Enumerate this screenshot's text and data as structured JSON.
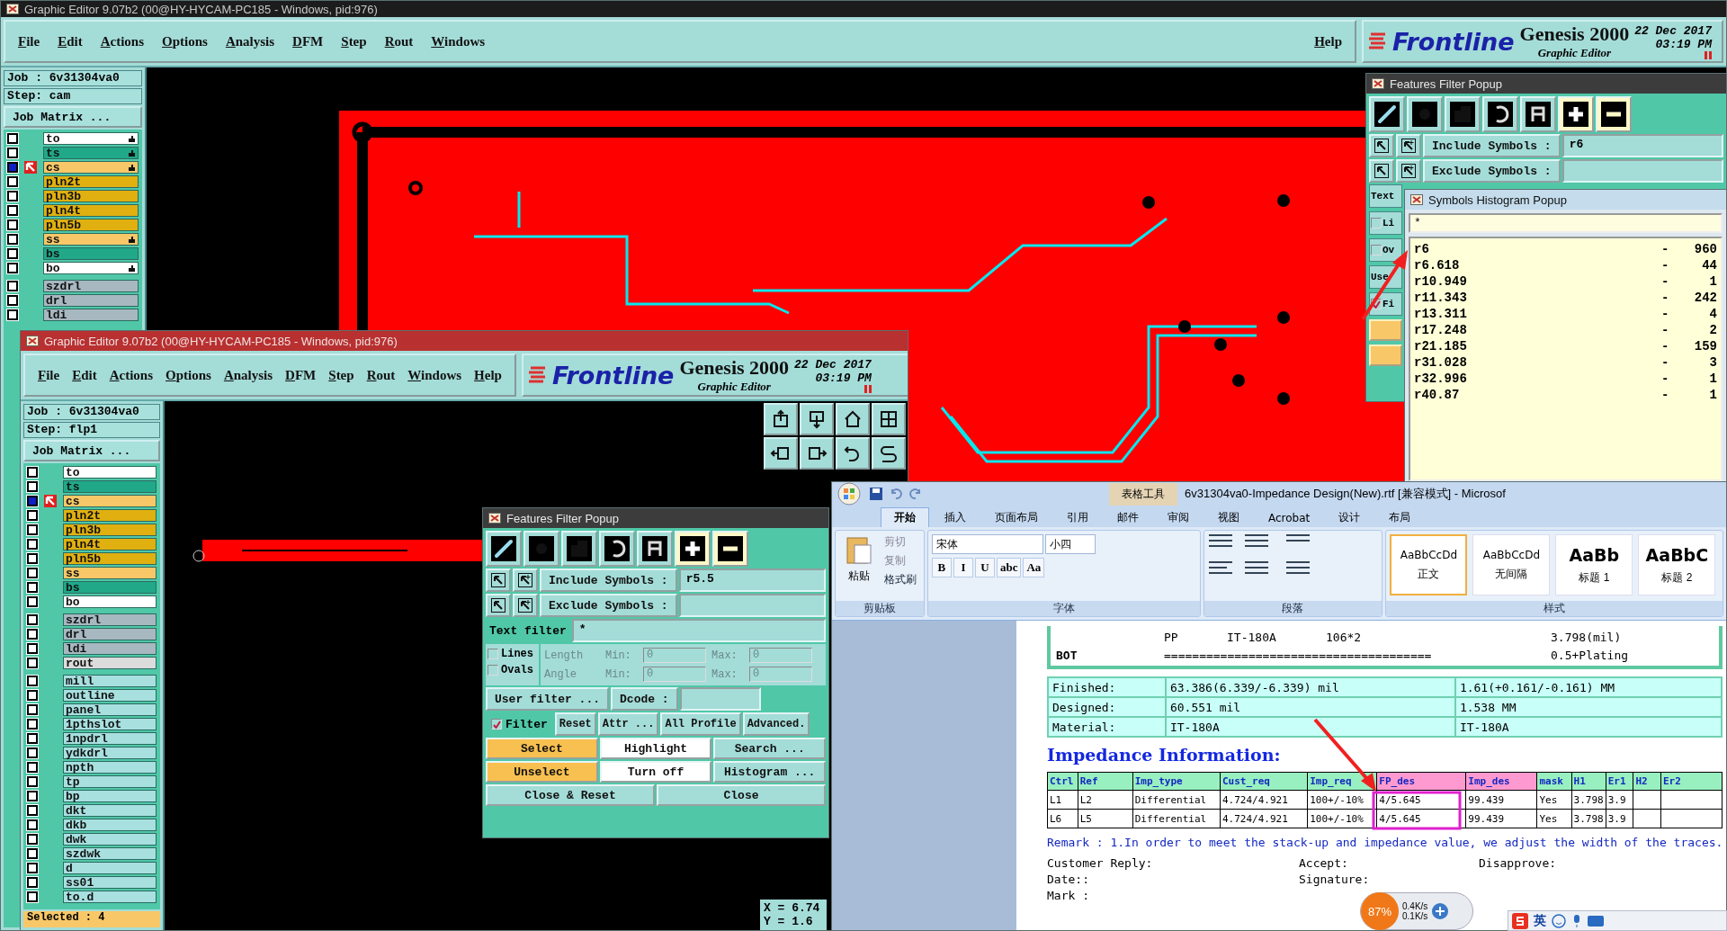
{
  "back_editor": {
    "title": "Graphic Editor 9.07b2 (00@HY-HYCAM-PC185 - Windows, pid:976)",
    "menu": [
      "File",
      "Edit",
      "Actions",
      "Options",
      "Analysis",
      "DFM",
      "Step",
      "Rout",
      "Windows"
    ],
    "help": "Help",
    "job": "Job : 6v31304va0",
    "step": "Step: cam",
    "job_matrix": "Job Matrix ...",
    "layer_groups": [
      {
        "layers": [
          {
            "name": "to",
            "color": "#ffffff",
            "selected": false,
            "affected": true
          },
          {
            "name": "ts",
            "color": "#20a888",
            "selected": false,
            "affected": true
          },
          {
            "name": "cs",
            "color": "#f8c868",
            "selected": true,
            "affected": true
          },
          {
            "name": "pln2t",
            "color": "#e0b010",
            "selected": false,
            "affected": false
          },
          {
            "name": "pln3b",
            "color": "#e0b010",
            "selected": false,
            "affected": false
          },
          {
            "name": "pln4t",
            "color": "#e0b010",
            "selected": false,
            "affected": false
          },
          {
            "name": "pln5b",
            "color": "#e0b010",
            "selected": false,
            "affected": false
          },
          {
            "name": "ss",
            "color": "#f8c868",
            "selected": false,
            "affected": true
          },
          {
            "name": "bs",
            "color": "#20a888",
            "selected": false,
            "affected": false
          },
          {
            "name": "bo",
            "color": "#ffffff",
            "selected": false,
            "affected": true
          }
        ]
      },
      {
        "layers": [
          {
            "name": "szdrl",
            "color": "#a8b8c0",
            "selected": false,
            "affected": false
          },
          {
            "name": "drl",
            "color": "#a8b8c0",
            "selected": false,
            "affected": false
          },
          {
            "name": "ldi",
            "color": "#a8b8c0",
            "selected": false,
            "affected": false
          }
        ]
      }
    ],
    "logo": {
      "brand": "Frontline",
      "product": "Genesis 2000",
      "subtitle": "Graphic Editor",
      "date": "22 Dec 2017",
      "time": "03:19 PM"
    }
  },
  "back_filter_popup": {
    "title": "Features Filter Popup",
    "include_label": "Include Symbols :",
    "include_value": "r6",
    "exclude_label": "Exclude Symbols :",
    "side_items": [
      {
        "label": "Text",
        "kind": "label"
      },
      {
        "label": "Li",
        "kind": "check",
        "checked": false
      },
      {
        "label": "Ov",
        "kind": "check",
        "checked": false
      },
      {
        "label": "Use",
        "kind": "button"
      },
      {
        "label": "Fi",
        "kind": "check",
        "checked": true
      }
    ]
  },
  "histogram": {
    "title": "Symbols Histogram Popup",
    "filter": "*",
    "rows": [
      {
        "symbol": "r6",
        "dash": "-",
        "count": "960"
      },
      {
        "symbol": "r6.618",
        "dash": "-",
        "count": "44"
      },
      {
        "symbol": "r10.949",
        "dash": "-",
        "count": "1"
      },
      {
        "symbol": "r11.343",
        "dash": "-",
        "count": "242"
      },
      {
        "symbol": "r13.311",
        "dash": "-",
        "count": "4"
      },
      {
        "symbol": "r17.248",
        "dash": "-",
        "count": "2"
      },
      {
        "symbol": "r21.185",
        "dash": "-",
        "count": "159"
      },
      {
        "symbol": "r31.028",
        "dash": "-",
        "count": "3"
      },
      {
        "symbol": "r32.996",
        "dash": "-",
        "count": "1"
      },
      {
        "symbol": "r40.87",
        "dash": "-",
        "count": "1"
      }
    ]
  },
  "front_editor": {
    "title": "Graphic Editor 9.07b2 (00@HY-HYCAM-PC185 - Windows, pid:976)",
    "menu": [
      "File",
      "Edit",
      "Actions",
      "Options",
      "Analysis",
      "DFM",
      "Step",
      "Rout",
      "Windows"
    ],
    "help": "Help",
    "job": "Job : 6v31304va0",
    "step": "Step: flp1",
    "job_matrix": "Job Matrix ...",
    "layer_groups": [
      {
        "layers": [
          {
            "name": "to",
            "color": "#ffffff",
            "selected": false,
            "affected": false
          },
          {
            "name": "ts",
            "color": "#20a888",
            "selected": false,
            "affected": false
          },
          {
            "name": "cs",
            "color": "#f8c868",
            "selected": true,
            "affected": false
          },
          {
            "name": "pln2t",
            "color": "#e0b010",
            "selected": false,
            "affected": false
          },
          {
            "name": "pln3b",
            "color": "#e0b010",
            "selected": false,
            "affected": false
          },
          {
            "name": "pln4t",
            "color": "#e0b010",
            "selected": false,
            "affected": false
          },
          {
            "name": "pln5b",
            "color": "#e0b010",
            "selected": false,
            "affected": false
          },
          {
            "name": "ss",
            "color": "#f8c868",
            "selected": false,
            "affected": false
          },
          {
            "name": "bs",
            "color": "#20a888",
            "selected": false,
            "affected": false
          },
          {
            "name": "bo",
            "color": "#ffffff",
            "selected": false,
            "affected": false
          }
        ]
      },
      {
        "layers": [
          {
            "name": "szdrl",
            "color": "#a8b8c0",
            "selected": false,
            "affected": false
          },
          {
            "name": "drl",
            "color": "#a8b8c0",
            "selected": false,
            "affected": false
          },
          {
            "name": "ldi",
            "color": "#a8b8c0",
            "selected": false,
            "affected": false
          },
          {
            "name": "rout",
            "color": "#dcdcdc",
            "selected": false,
            "affected": false
          }
        ]
      },
      {
        "layers": [
          {
            "name": "mill",
            "color": "#a8e0e0",
            "selected": false,
            "affected": false
          },
          {
            "name": "outline",
            "color": "#a8e0e0",
            "selected": false,
            "affected": false
          },
          {
            "name": "panel",
            "color": "#a8e0e0",
            "selected": false,
            "affected": false
          },
          {
            "name": "1pthslot",
            "color": "#a8e0e0",
            "selected": false,
            "affected": false
          },
          {
            "name": "1npdrl",
            "color": "#a8e0e0",
            "selected": false,
            "affected": false
          },
          {
            "name": "ydkdrl",
            "color": "#a8e0e0",
            "selected": false,
            "affected": false
          },
          {
            "name": "npth",
            "color": "#a8e0e0",
            "selected": false,
            "affected": false
          },
          {
            "name": "tp",
            "color": "#a8e0e0",
            "selected": false,
            "affected": false
          },
          {
            "name": "bp",
            "color": "#a8e0e0",
            "selected": false,
            "affected": false
          },
          {
            "name": "dkt",
            "color": "#a8e0e0",
            "selected": false,
            "affected": false
          },
          {
            "name": "dkb",
            "color": "#a8e0e0",
            "selected": false,
            "affected": false
          },
          {
            "name": "dwk",
            "color": "#a8e0e0",
            "selected": false,
            "affected": false
          },
          {
            "name": "szdwk",
            "color": "#a8e0e0",
            "selected": false,
            "affected": false
          },
          {
            "name": "d",
            "color": "#a8e0e0",
            "selected": false,
            "affected": false
          },
          {
            "name": "ss01",
            "color": "#a8e0e0",
            "selected": false,
            "affected": false
          },
          {
            "name": "to.d",
            "color": "#a8e0e0",
            "selected": false,
            "affected": false
          }
        ]
      }
    ],
    "status": "Selected : 4",
    "coords": [
      "X = 6.74",
      "Y = 1.6"
    ],
    "logo": {
      "brand": "Frontline",
      "product": "Genesis 2000",
      "subtitle": "Graphic Editor",
      "date": "22 Dec 2017",
      "time": "03:19 PM"
    }
  },
  "front_filter_popup": {
    "title": "Features Filter Popup",
    "include_label": "Include Symbols :",
    "include_value": "r5.5",
    "exclude_label": "Exclude Symbols :",
    "text_filter_label": "Text filter",
    "text_filter_value": "*",
    "types": [
      {
        "label": "Lines",
        "checked": false
      },
      {
        "label": "Ovals",
        "checked": false
      }
    ],
    "ranges": [
      {
        "label": "Length",
        "min_label": "Min:",
        "min": "0",
        "max_label": "Max:",
        "max": "0",
        "disabled": true
      },
      {
        "label": "Angle",
        "min_label": "Min:",
        "min": "0",
        "max_label": "Max:",
        "max": "0",
        "disabled": true
      }
    ],
    "user_filter": "User filter ...",
    "dcode_label": "Dcode :",
    "filter": {
      "label": "Filter",
      "checked": true
    },
    "option_buttons": [
      "Reset",
      "Attr ...",
      "All Profile",
      "Advanced."
    ],
    "actions": [
      {
        "label": "Select",
        "kind": "primary"
      },
      {
        "label": "Highlight",
        "kind": "light"
      },
      {
        "label": "Search ...",
        "kind": "plain"
      },
      {
        "label": "Unselect",
        "kind": "primary"
      },
      {
        "label": "Turn off",
        "kind": "light"
      },
      {
        "label": "Histogram ...",
        "kind": "plain"
      }
    ],
    "close_buttons": [
      "Close & Reset",
      "Close"
    ]
  },
  "word": {
    "context_tab": "表格工具",
    "title": "6v31304va0-Impedance Design(New).rtf [兼容模式] - Microsof",
    "tabs": [
      {
        "label": "开始",
        "selected": true
      },
      {
        "label": "插入",
        "selected": false
      },
      {
        "label": "页面布局",
        "selected": false
      },
      {
        "label": "引用",
        "selected": false
      },
      {
        "label": "邮件",
        "selected": false
      },
      {
        "label": "审阅",
        "selected": false
      },
      {
        "label": "视图",
        "selected": false
      },
      {
        "label": "Acrobat",
        "selected": false
      },
      {
        "label": "设计",
        "selected": false
      },
      {
        "label": "布局",
        "selected": false
      }
    ],
    "clipboard": {
      "paste": "粘贴",
      "cut": "剪切",
      "copy": "复制",
      "painter": "格式刷",
      "label": "剪贴板"
    },
    "font": {
      "name": "宋体",
      "size": "小四",
      "buttons": [
        "B",
        "I",
        "U",
        "abc",
        "Aa"
      ],
      "label": "字体"
    },
    "paragraph": {
      "label": "段落"
    },
    "styles": {
      "items": [
        {
          "preview": "AaBbCcDd",
          "name": "正文",
          "selected": true
        },
        {
          "preview": "AaBbCcDd",
          "name": "无间隔",
          "selected": false
        },
        {
          "preview": "AaBb",
          "name": "标题 1",
          "selected": false
        },
        {
          "preview": "AaBbC",
          "name": "标题 2",
          "selected": false
        }
      ],
      "label": "样式"
    },
    "stackup": [
      {
        "cells": [
          null,
          "PP",
          "IT-180A",
          "106*2",
          "3.798(mil)"
        ]
      },
      {
        "cells": [
          "BOT",
          "======================================",
          null,
          null,
          "0.5+Plating"
        ]
      }
    ],
    "summary": [
      {
        "cells": [
          "Finished:",
          "63.386(6.339/-6.339) mil",
          "1.61(+0.161/-0.161) MM"
        ]
      },
      {
        "cells": [
          "Designed:",
          "60.551 mil",
          "1.538 MM"
        ]
      },
      {
        "cells": [
          "Material:",
          "IT-180A",
          "IT-180A"
        ]
      }
    ],
    "heading": "Impedance Information:",
    "impedance_columns": [
      {
        "label": "Ctrl",
        "color": "#98f0c0"
      },
      {
        "label": "Ref",
        "color": "#98f0c0"
      },
      {
        "label": "Imp_type",
        "color": "#98f0c0"
      },
      {
        "label": "Cust_req",
        "color": "#98f0c0"
      },
      {
        "label": "Imp_req",
        "color": "#98f0c0"
      },
      {
        "label": "FP_des",
        "color": "#ff9ad0"
      },
      {
        "label": "Imp_des",
        "color": "#ff9ad0"
      },
      {
        "label": "mask",
        "color": "#98f0c0"
      },
      {
        "label": "H1",
        "color": "#98f0c0"
      },
      {
        "label": "Er1",
        "color": "#98f0c0"
      },
      {
        "label": "H2",
        "color": "#98f0c0"
      },
      {
        "label": "Er2",
        "color": "#98f0c0"
      }
    ],
    "impedance_rows": [
      {
        "cells": [
          "L1",
          "L2",
          "Differential",
          "4.724/4.921",
          "100+/-10%",
          "4/5.645",
          "99.439",
          "Yes",
          "3.798",
          "3.9",
          null,
          null
        ]
      },
      {
        "cells": [
          "L6",
          "L5",
          "Differential",
          "4.724/4.921",
          "100+/-10%",
          "4/5.645",
          "99.439",
          "Yes",
          "3.798",
          "3.9",
          null,
          null
        ]
      }
    ],
    "remark": "Remark : 1.In order to meet the stack-up and impedance value, we adjust the width of the traces.",
    "reply_rows": [
      [
        "Customer Reply:",
        "Accept:",
        "Disapprove:"
      ],
      [
        "Date::",
        "Signature:"
      ],
      [
        "Mark :"
      ]
    ]
  },
  "network_widget": {
    "load": "87%",
    "upload": "0.4K/s",
    "download": "0.1K/s"
  },
  "ime_bar": {
    "language": "英"
  }
}
